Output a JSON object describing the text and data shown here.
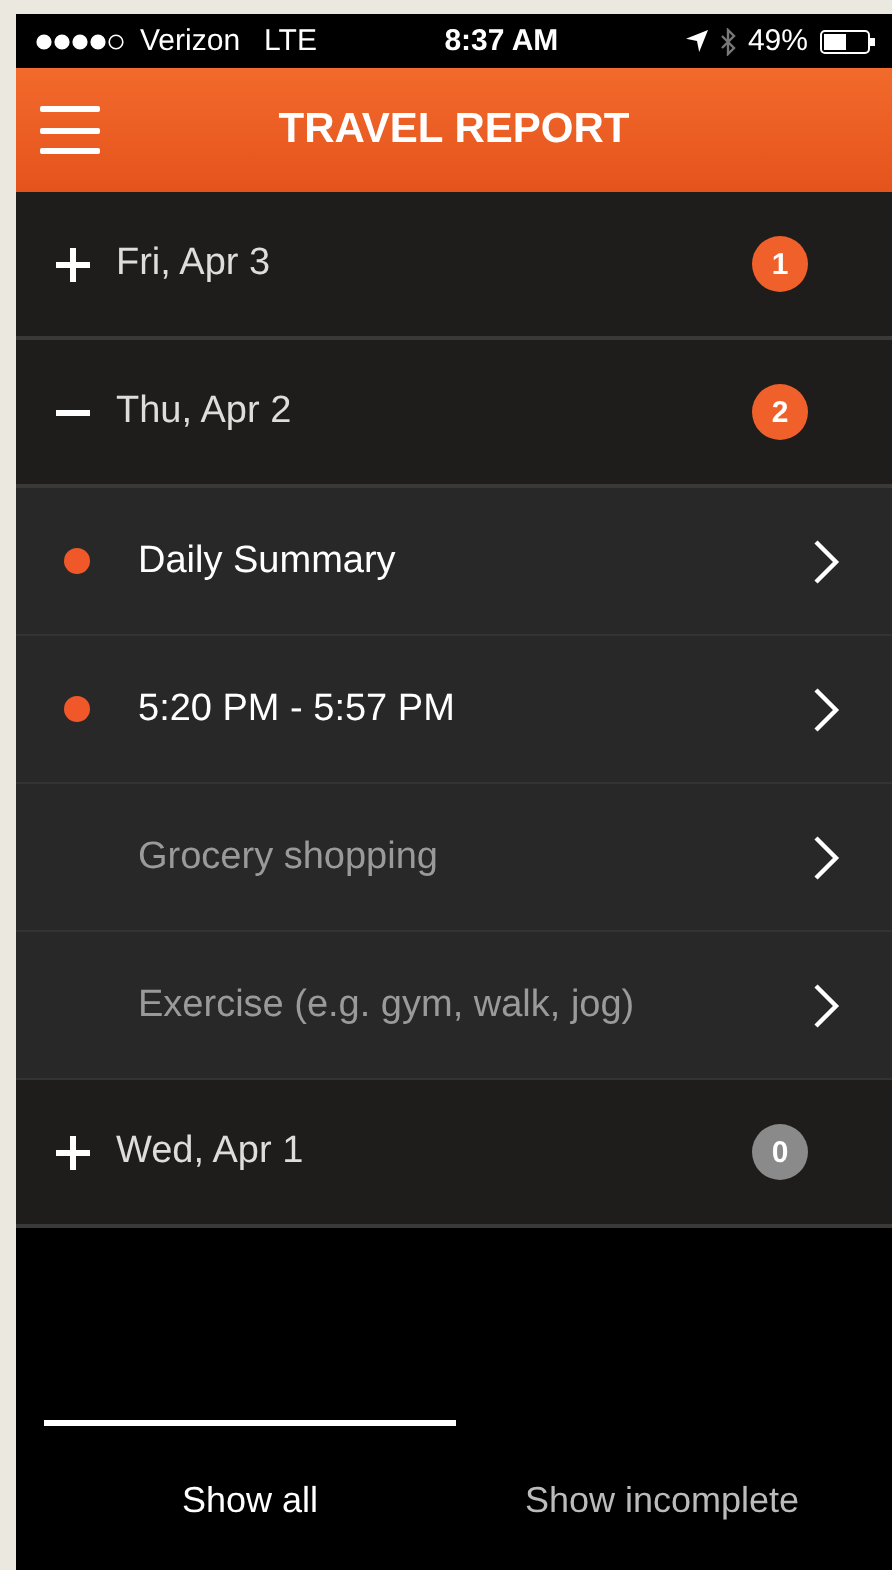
{
  "status_bar": {
    "carrier": "Verizon",
    "network": "LTE",
    "time": "8:37 AM",
    "battery": "49%"
  },
  "header": {
    "title": "TRAVEL REPORT"
  },
  "days": [
    {
      "label": "Fri, Apr 3",
      "expanded": false,
      "badge": "1",
      "color": "#f0602a"
    },
    {
      "label": "Thu, Apr 2",
      "expanded": true,
      "badge": "2",
      "color": "#f0602a",
      "children": [
        {
          "label": "Daily Summary",
          "incomplete": true
        },
        {
          "label": "5:20 PM - 5:57 PM",
          "incomplete": true
        },
        {
          "label": "Grocery shopping",
          "incomplete": false
        },
        {
          "label": "Exercise (e.g. gym, walk, jog)",
          "incomplete": false
        }
      ]
    },
    {
      "label": "Wed, Apr 1",
      "expanded": false,
      "badge": "0",
      "color": "#8a8a8a"
    }
  ],
  "tabs": [
    {
      "label": "Show all",
      "selected": true
    },
    {
      "label": "Show incomplete",
      "selected": false
    }
  ]
}
